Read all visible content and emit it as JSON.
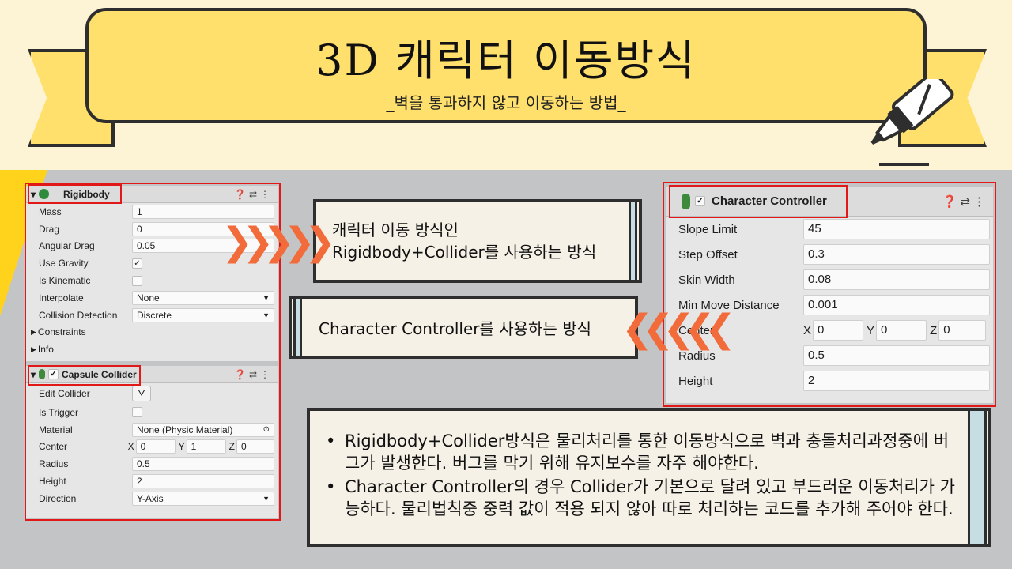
{
  "banner": {
    "title": "3D 캐릭터 이동방식",
    "subtitle": "_벽을 통과하지 않고 이동하는 방법_"
  },
  "rigidbody": {
    "title": "Rigidbody",
    "rows": [
      {
        "label": "Mass",
        "value": "1"
      },
      {
        "label": "Drag",
        "value": "0"
      },
      {
        "label": "Angular Drag",
        "value": "0.05"
      },
      {
        "label": "Use Gravity",
        "value": "✓"
      },
      {
        "label": "Is Kinematic",
        "value": ""
      },
      {
        "label": "Interpolate",
        "value": "None"
      },
      {
        "label": "Collision Detection",
        "value": "Discrete"
      }
    ],
    "constraints": "Constraints",
    "info": "Info"
  },
  "capsule": {
    "title": "Capsule Collider",
    "rows": [
      {
        "label": "Edit Collider",
        "value": ""
      },
      {
        "label": "Is Trigger",
        "value": ""
      },
      {
        "label": "Material",
        "value": "None (Physic Material)"
      },
      {
        "label": "Center",
        "x": "0",
        "y": "1",
        "z": "0"
      },
      {
        "label": "Radius",
        "value": "0.5"
      },
      {
        "label": "Height",
        "value": "2"
      },
      {
        "label": "Direction",
        "value": "Y-Axis"
      }
    ]
  },
  "charcontroller": {
    "title": "Character Controller",
    "rows": [
      {
        "label": "Slope Limit",
        "value": "45"
      },
      {
        "label": "Step Offset",
        "value": "0.3"
      },
      {
        "label": "Skin Width",
        "value": "0.08"
      },
      {
        "label": "Min Move Distance",
        "value": "0.001"
      },
      {
        "label": "Center",
        "x": "0",
        "y": "0",
        "z": "0"
      },
      {
        "label": "Radius",
        "value": "0.5"
      },
      {
        "label": "Height",
        "value": "2"
      }
    ]
  },
  "callout_rigidbody": "캐릭터 이동 방식인 Rigidbody+Collider를 사용하는 방식",
  "callout_cc": "Character Controller를 사용하는 방식",
  "bullets": [
    "Rigidbody+Collider방식은 물리처리를 통한 이동방식으로 벽과 충돌처리과정중에 버그가 발생한다. 버그를 막기 위해 유지보수를 자주 해야한다.",
    "Character Controller의 경우 Collider가 기본으로 달려 있고 부드러운 이동처리가 가능하다. 물리법칙중 중력 값이 적용 되지 않아 따로 처리하는 코드를 추가해 주어야 한다."
  ],
  "axis_labels": {
    "x": "X",
    "y": "Y",
    "z": "Z"
  },
  "colors": {
    "banner": "#ffe06c",
    "highlight": "#e01818",
    "arrow": "#f26b3a"
  }
}
